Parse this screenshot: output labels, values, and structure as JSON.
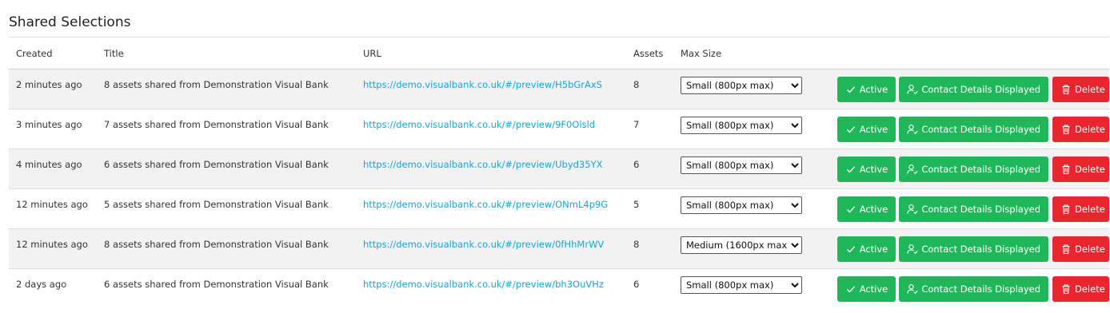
{
  "page": {
    "title": "Shared Selections"
  },
  "colors": {
    "accent_green": "#20b65a",
    "danger_red": "#e8262f",
    "link": "#1aa3d8"
  },
  "table": {
    "headers": [
      "Created",
      "Title",
      "URL",
      "Assets",
      "Max Size"
    ],
    "rows": [
      {
        "created": "2 minutes ago",
        "title": "8 assets shared from Demonstration Visual Bank",
        "url": "https://demo.visualbank.co.uk/#/preview/H5bGrAxS",
        "assets": "8",
        "max_size": "Small (800px max)",
        "active_label": "Active",
        "contact_label": "Contact Details Displayed",
        "delete_label": "Delete"
      },
      {
        "created": "3 minutes ago",
        "title": "7 assets shared from Demonstration Visual Bank",
        "url": "https://demo.visualbank.co.uk/#/preview/9F0Olsld",
        "assets": "7",
        "max_size": "Small (800px max)",
        "active_label": "Active",
        "contact_label": "Contact Details Displayed",
        "delete_label": "Delete"
      },
      {
        "created": "4 minutes ago",
        "title": "6 assets shared from Demonstration Visual Bank",
        "url": "https://demo.visualbank.co.uk/#/preview/Ubyd35YX",
        "assets": "6",
        "max_size": "Small (800px max)",
        "active_label": "Active",
        "contact_label": "Contact Details Displayed",
        "delete_label": "Delete"
      },
      {
        "created": "12 minutes ago",
        "title": "5 assets shared from Demonstration Visual Bank",
        "url": "https://demo.visualbank.co.uk/#/preview/ONmL4p9G",
        "assets": "5",
        "max_size": "Small (800px max)",
        "active_label": "Active",
        "contact_label": "Contact Details Displayed",
        "delete_label": "Delete"
      },
      {
        "created": "12 minutes ago",
        "title": "8 assets shared from Demonstration Visual Bank",
        "url": "https://demo.visualbank.co.uk/#/preview/0fHhMrWV",
        "assets": "8",
        "max_size": "Medium (1600px max)",
        "active_label": "Active",
        "contact_label": "Contact Details Displayed",
        "delete_label": "Delete"
      },
      {
        "created": "2 days ago",
        "title": "6 assets shared from Demonstration Visual Bank",
        "url": "https://demo.visualbank.co.uk/#/preview/bh3OuVHz",
        "assets": "6",
        "max_size": "Small (800px max)",
        "active_label": "Active",
        "contact_label": "Contact Details Displayed",
        "delete_label": "Delete"
      }
    ]
  },
  "icons": {
    "active": "check-icon",
    "contact": "user-check-icon",
    "delete": "trash-icon"
  }
}
